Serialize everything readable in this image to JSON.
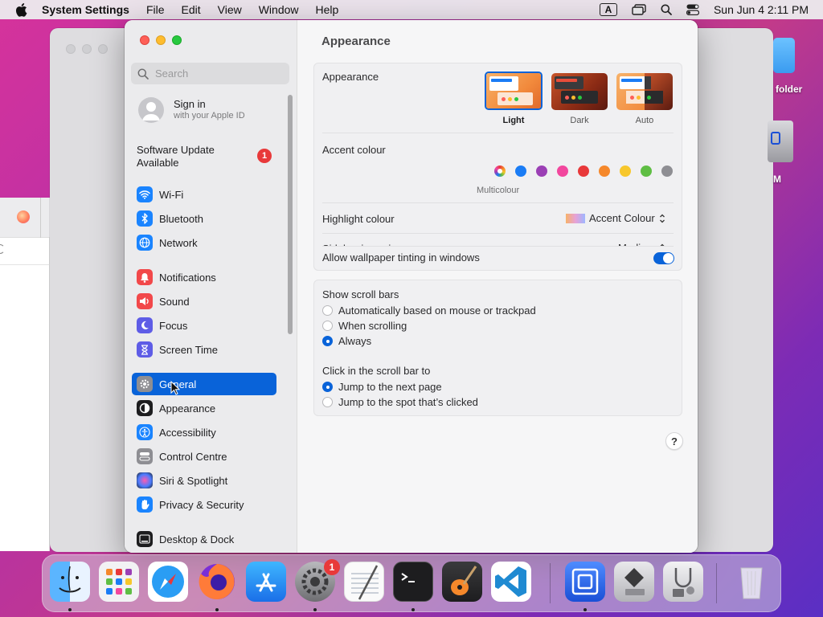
{
  "menubar": {
    "app_name": "System Settings",
    "menus": [
      "File",
      "Edit",
      "View",
      "Window",
      "Help"
    ],
    "input_indicator": "A",
    "datetime": "Sun Jun 4  2:11 PM"
  },
  "desktop": {
    "folder_label": "folder",
    "partial_label": "M"
  },
  "sidebar": {
    "search_placeholder": "Search",
    "signin_title": "Sign in",
    "signin_subtitle": "with your Apple ID",
    "update_label": "Software Update Available",
    "update_badge": "1",
    "items": [
      {
        "label": "Wi-Fi",
        "icon": "wifi-icon",
        "color": "#1a84ff"
      },
      {
        "label": "Bluetooth",
        "icon": "bluetooth-icon",
        "color": "#1a84ff"
      },
      {
        "label": "Network",
        "icon": "network-icon",
        "color": "#1a84ff"
      },
      {
        "label": "Notifications",
        "icon": "bell-icon",
        "color": "#f2484a"
      },
      {
        "label": "Sound",
        "icon": "speaker-icon",
        "color": "#f2484a"
      },
      {
        "label": "Focus",
        "icon": "moon-icon",
        "color": "#5e5ce6"
      },
      {
        "label": "Screen Time",
        "icon": "hourglass-icon",
        "color": "#5e5ce6"
      },
      {
        "label": "General",
        "icon": "gear-icon",
        "color": "#8e8e93",
        "selected": true
      },
      {
        "label": "Appearance",
        "icon": "appearance-icon",
        "color": "#1d1d1f"
      },
      {
        "label": "Accessibility",
        "icon": "accessibility-icon",
        "color": "#1a84ff"
      },
      {
        "label": "Control Centre",
        "icon": "control-centre-icon",
        "color": "#8e8e93"
      },
      {
        "label": "Siri & Spotlight",
        "icon": "siri-icon",
        "color": "#7a3fd1"
      },
      {
        "label": "Privacy & Security",
        "icon": "hand-icon",
        "color": "#1a84ff"
      },
      {
        "label": "Desktop & Dock",
        "icon": "dock-icon",
        "color": "#1d1d1f"
      }
    ]
  },
  "content": {
    "title": "Appearance",
    "appearance_label": "Appearance",
    "modes": [
      {
        "label": "Light",
        "selected": true
      },
      {
        "label": "Dark",
        "selected": false
      },
      {
        "label": "Auto",
        "selected": false
      }
    ],
    "accent_label": "Accent colour",
    "accent_colors": [
      "multicolour",
      "#1a7cf5",
      "#9b3fb5",
      "#f2479e",
      "#e8383a",
      "#f5882b",
      "#f7c72c",
      "#5fbe44",
      "#8e8e93"
    ],
    "accent_selected_name": "Multicolour",
    "highlight_label": "Highlight colour",
    "highlight_value": "Accent Colour",
    "sidebar_icon_label": "Sidebar icon size",
    "sidebar_icon_value": "Medium",
    "tinting_label": "Allow wallpaper tinting in windows",
    "tinting_on": true,
    "scroll_bars_label": "Show scroll bars",
    "scroll_options": [
      {
        "label": "Automatically based on mouse or trackpad",
        "selected": false
      },
      {
        "label": "When scrolling",
        "selected": false
      },
      {
        "label": "Always",
        "selected": true
      }
    ],
    "click_label": "Click in the scroll bar to",
    "click_options": [
      {
        "label": "Jump to the next page",
        "selected": true
      },
      {
        "label": "Jump to the spot that’s clicked",
        "selected": false
      }
    ],
    "help": "?"
  },
  "dock": {
    "apps": [
      "Finder",
      "Launchpad",
      "Safari",
      "Firefox",
      "App Store",
      "System Settings",
      "TextEdit",
      "Terminal",
      "GarageBand",
      "Visual Studio Code",
      "Screen Sharing",
      "Boot Camp Assistant",
      "Disk Utility",
      "Trash"
    ],
    "settings_badge": "1"
  }
}
